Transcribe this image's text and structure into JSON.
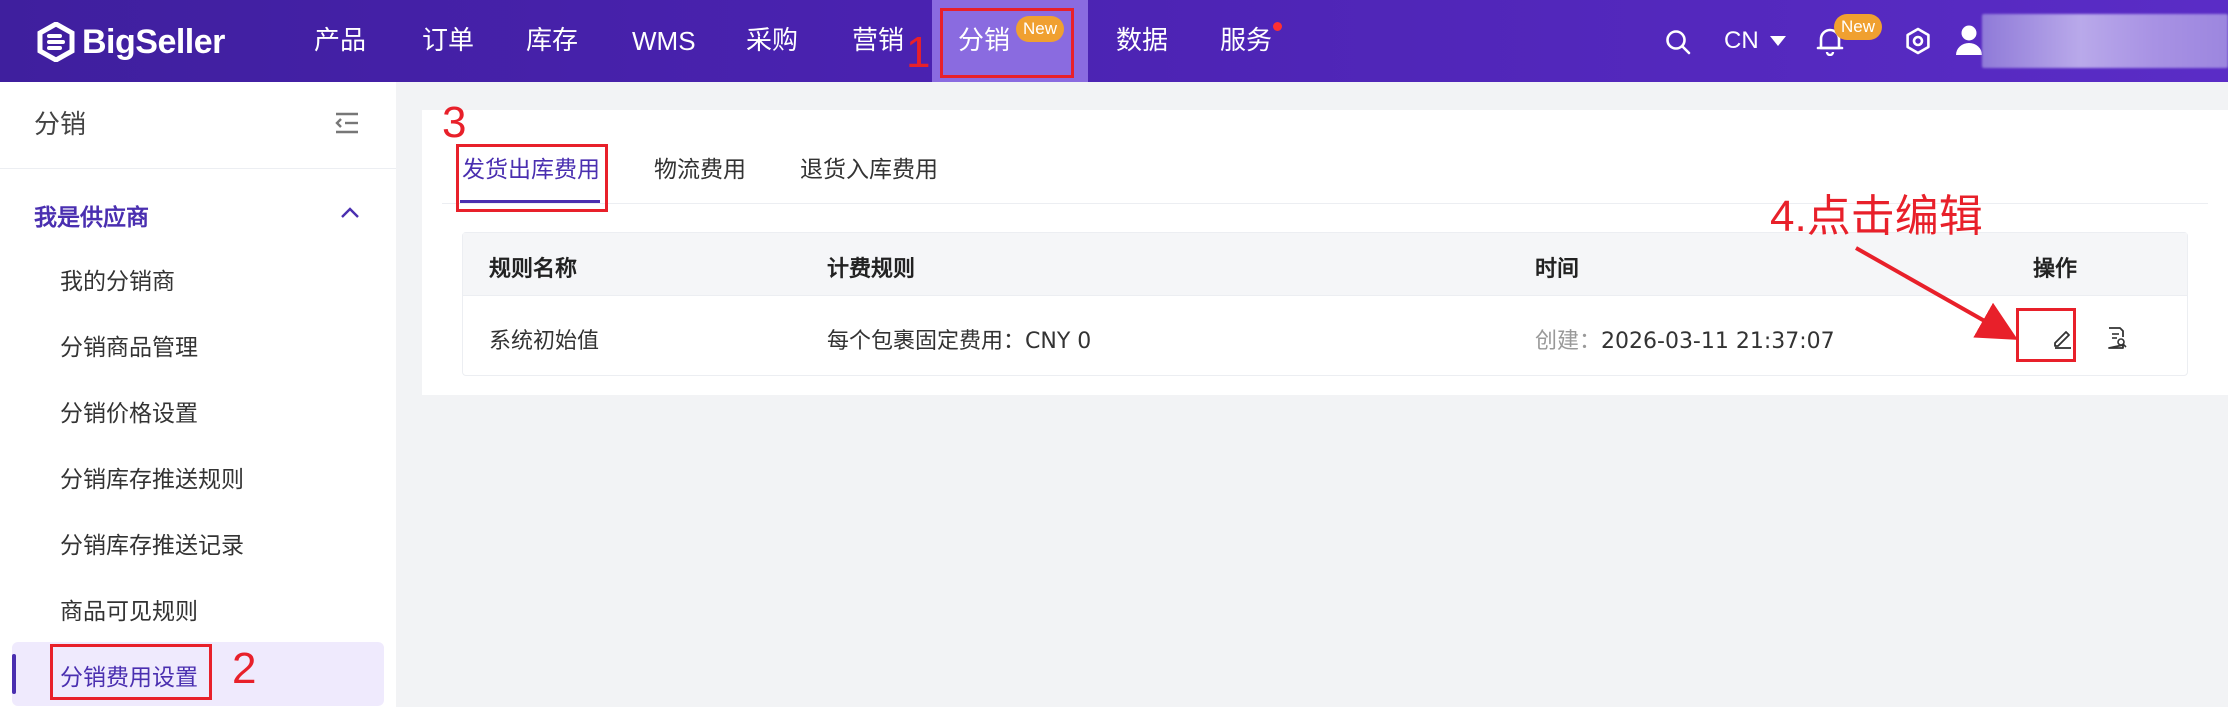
{
  "brand": {
    "name": "BigSeller"
  },
  "nav": {
    "items": [
      {
        "label": "产品"
      },
      {
        "label": "订单"
      },
      {
        "label": "库存"
      },
      {
        "label": "WMS"
      },
      {
        "label": "采购"
      },
      {
        "label": "营销"
      },
      {
        "label": "分销",
        "badge": "New",
        "active": true
      },
      {
        "label": "数据"
      },
      {
        "label": "服务",
        "dot": true
      }
    ],
    "language": "CN",
    "notification_badge": "New"
  },
  "sidebar": {
    "title": "分销",
    "group_label": "我是供应商",
    "items": [
      {
        "label": "我的分销商"
      },
      {
        "label": "分销商品管理"
      },
      {
        "label": "分销价格设置"
      },
      {
        "label": "分销库存推送规则"
      },
      {
        "label": "分销库存推送记录"
      },
      {
        "label": "商品可见规则"
      },
      {
        "label": "分销费用设置",
        "active": true
      }
    ]
  },
  "tabs": [
    {
      "label": "发货出库费用",
      "active": true
    },
    {
      "label": "物流费用"
    },
    {
      "label": "退货入库费用"
    }
  ],
  "table": {
    "columns": [
      "规则名称",
      "计费规则",
      "时间",
      "操作"
    ],
    "rows": [
      {
        "name": "系统初始值",
        "rule": "每个包裹固定费用：CNY 0",
        "time_prefix": "创建：",
        "time": "2026-03-11 21:37:07"
      }
    ]
  },
  "annotations": {
    "step1": "1",
    "step2": "2",
    "step3": "3",
    "step4": "4.点击编辑"
  },
  "colors": {
    "nav_bg": "#4a22b0",
    "accent": "#4a2fb0",
    "annotation_red": "#e8202a",
    "badge_orange": "#f0a030"
  }
}
